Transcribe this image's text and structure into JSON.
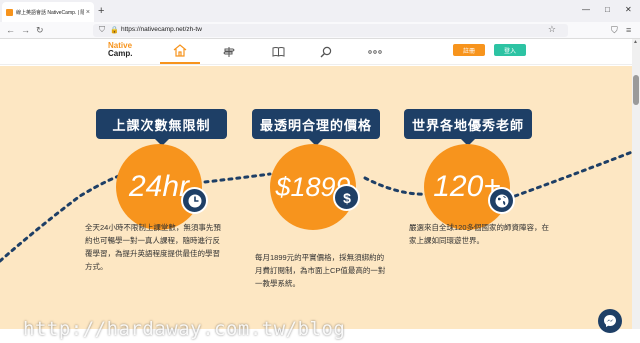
{
  "browser": {
    "tab_title": "線上英語會話 NativeCamp. | 隨",
    "tab_close": "×",
    "new_tab": "+",
    "url": "https://nativecamp.net/zh-tw",
    "window_controls": {
      "minimize": "—",
      "maximize": "□",
      "close": "✕"
    }
  },
  "site": {
    "logo_line1": "Native",
    "logo_line2": "Camp.",
    "nav_icons": [
      "home-icon",
      "signpost-icon",
      "book-icon",
      "search-icon",
      "more-icon"
    ],
    "register_label": "註冊",
    "login_label": "登入"
  },
  "features": [
    {
      "banner": "上課次數無限制",
      "stat": "24hr",
      "badge_icon": "clock-icon",
      "desc": "全天24小時不限制上課堂數，無須事先預約也可暢學一對一真人課程，隨時進行反覆學習，為提升英語程度提供最佳的學習方式。"
    },
    {
      "banner": "最透明合理的價格",
      "stat": "$1899",
      "badge_icon": "dollar-icon",
      "desc": "每月1899元的平實價格，採無須綁約的月費訂閱制，為市面上CP值最高的一對一教學系統。"
    },
    {
      "banner": "世界各地優秀老師",
      "stat": "120+",
      "badge_icon": "globe-icon",
      "desc": "嚴選來自全球120多個國家的師資陣容，在家上課如同環遊世界。"
    }
  ],
  "watermark": "http://hardaway.com.tw/blog",
  "colors": {
    "accent": "#f7941d",
    "navy": "#1e3f66",
    "cream": "#fde7c3",
    "login": "#2dc3a3"
  }
}
